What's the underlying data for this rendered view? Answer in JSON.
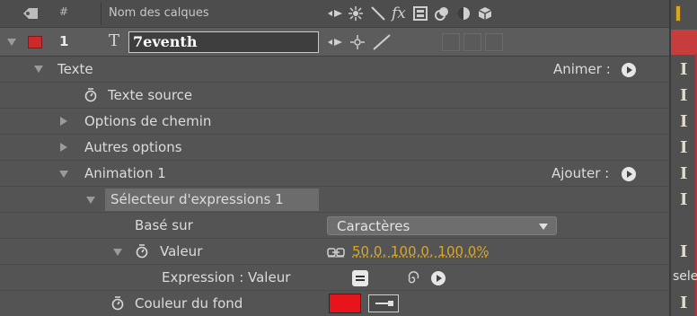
{
  "header": {
    "number_col": "#",
    "name_col": "Nom des calques",
    "fx_label": "fx"
  },
  "layer": {
    "number": "1",
    "type_glyph": "T",
    "name": "7eventh",
    "label_color": "#cc2a2a"
  },
  "rows": {
    "texte": "Texte",
    "animer": "Animer :",
    "texte_source": "Texte source",
    "options_chemin": "Options de chemin",
    "autres_options": "Autres options",
    "animation1": "Animation 1",
    "ajouter": "Ajouter :",
    "selecteur": "Sélecteur d'expressions 1",
    "base_sur": "Basé sur",
    "base_sur_value": "Caractères",
    "valeur": "Valeur",
    "valeur_value": "50,0, 100,0, 100,0%",
    "expression_valeur": "Expression : Valeur",
    "couleur_fond": "Couleur du fond",
    "couleur_fond_color": "#e8141b",
    "timeline_expr_text": "sele"
  },
  "colors": {
    "accent_yellow": "#d7a72a",
    "selection_bg": "#6a6a6a",
    "key_marker": "#e2dccc"
  }
}
